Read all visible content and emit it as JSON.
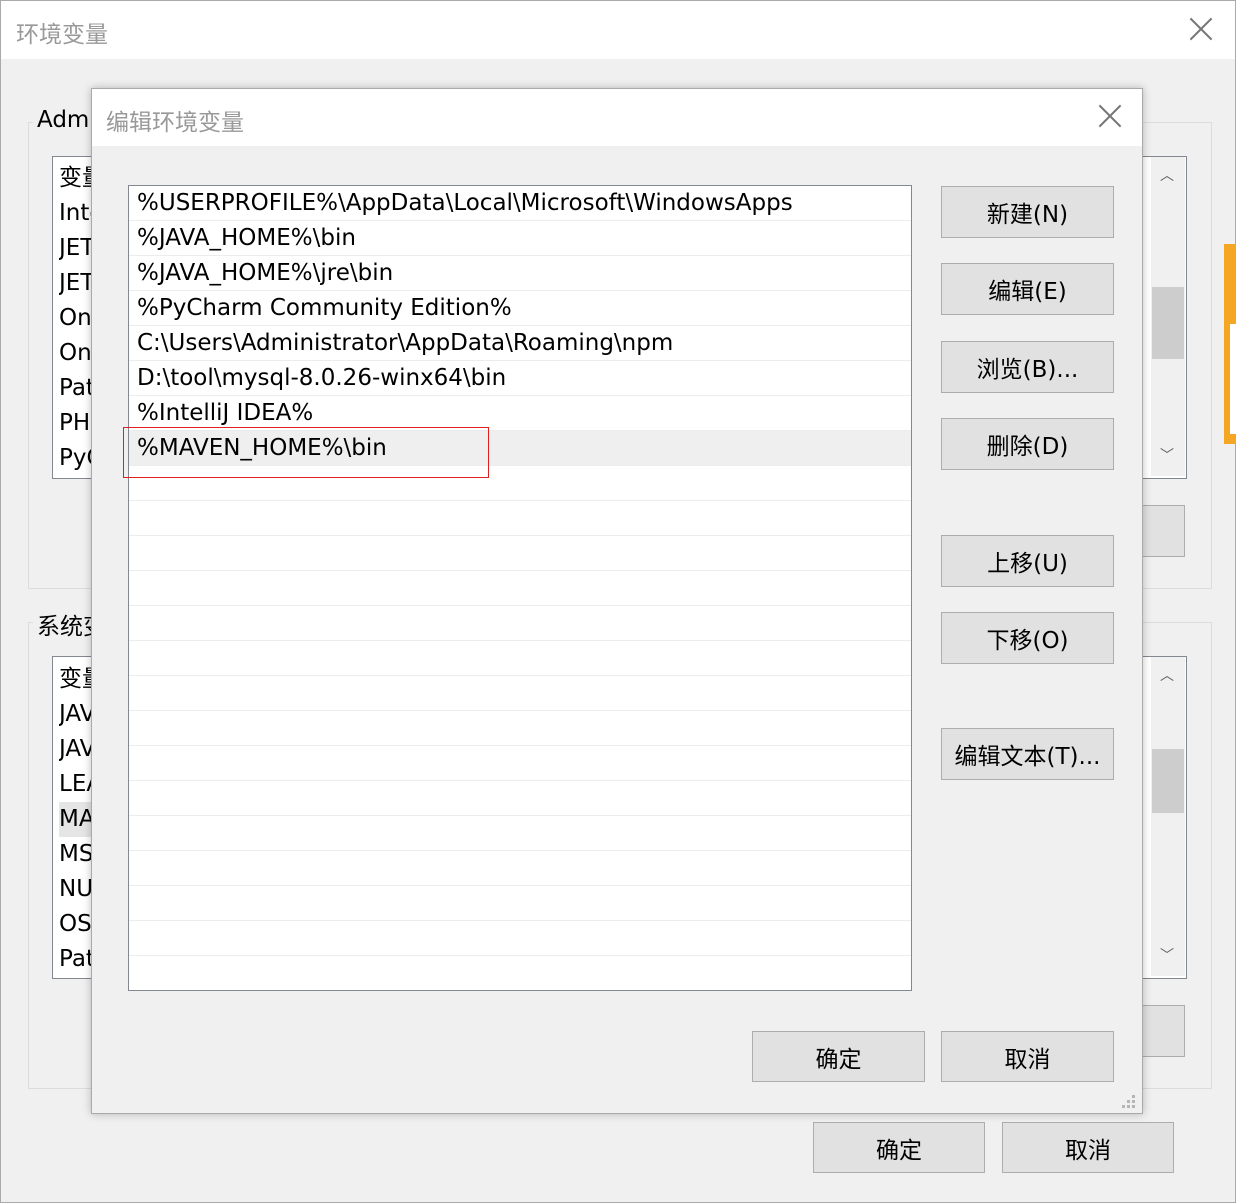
{
  "outer": {
    "title": "环境变量",
    "user_group_label": "Admi",
    "user_vars_stubs": [
      "变量",
      "Inte",
      "JET",
      "JET",
      "On",
      "On",
      "Pat",
      "PH",
      "PyC"
    ],
    "system_group_label": "系统变",
    "system_vars_stubs": [
      "变量",
      "JAV",
      "JAV",
      "LEA",
      "MA",
      "MS",
      "NU",
      "OS",
      "Pat"
    ],
    "ok_label": "确定",
    "cancel_label": "取消"
  },
  "edit_dialog": {
    "title": "编辑环境变量",
    "paths": [
      "%USERPROFILE%\\AppData\\Local\\Microsoft\\WindowsApps",
      "%JAVA_HOME%\\bin",
      "%JAVA_HOME%\\jre\\bin",
      "%PyCharm Community Edition%",
      "C:\\Users\\Administrator\\AppData\\Roaming\\npm",
      "D:\\tool\\mysql-8.0.26-winx64\\bin",
      "%IntelliJ IDEA%",
      "%MAVEN_HOME%\\bin"
    ],
    "selected_index": 7,
    "buttons": {
      "new": "新建(N)",
      "edit": "编辑(E)",
      "browse": "浏览(B)...",
      "delete": "删除(D)",
      "move_up": "上移(U)",
      "move_down": "下移(O)",
      "edit_text": "编辑文本(T)..."
    },
    "ok_label": "确定",
    "cancel_label": "取消"
  },
  "colors": {
    "highlight_border": "#e02020",
    "side_strip": "#f5a623"
  }
}
